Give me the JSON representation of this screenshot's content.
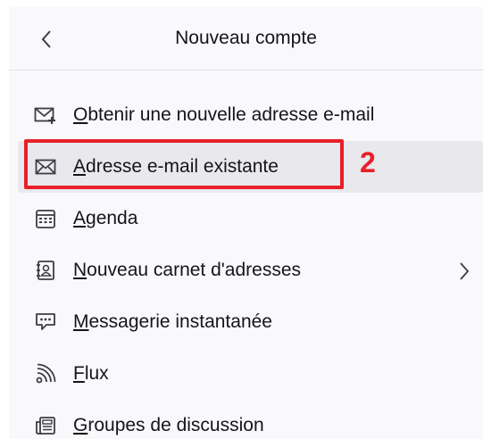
{
  "header": {
    "title": "Nouveau compte",
    "back_icon": "chevron-left-icon"
  },
  "menu": {
    "items": [
      {
        "label": "Obtenir une nouvelle adresse e-mail",
        "icon": "mail-plus-icon"
      },
      {
        "label": "Adresse e-mail existante",
        "icon": "mail-icon",
        "selected": true
      },
      {
        "label": "Agenda",
        "icon": "calendar-icon"
      },
      {
        "label": "Nouveau carnet d'adresses",
        "icon": "address-book-icon",
        "has_submenu": true
      },
      {
        "label": "Messagerie instantanée",
        "icon": "chat-icon"
      },
      {
        "label": "Flux",
        "icon": "rss-icon"
      },
      {
        "label": "Groupes de discussion",
        "icon": "newsgroup-icon"
      }
    ]
  },
  "annotation": {
    "step": "2",
    "color": "#e8202a"
  },
  "colors": {
    "panel_bg": "#f9f9fb",
    "selected_bg": "#e9e9ed",
    "text": "#15141a",
    "icon": "#3d3c44"
  }
}
